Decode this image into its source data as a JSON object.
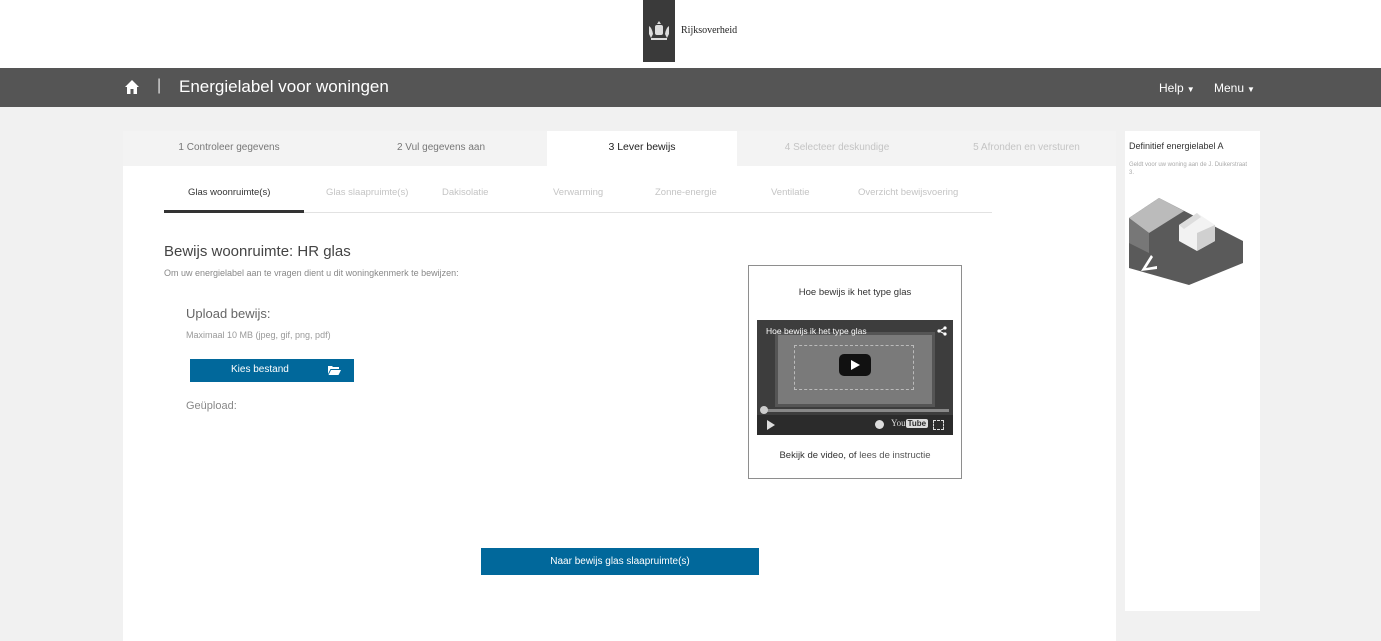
{
  "header": {
    "logo_text": "Rijksoverheid"
  },
  "navbar": {
    "separator": "|",
    "title": "Energielabel voor woningen",
    "help": "Help",
    "menu": "Menu"
  },
  "steps": [
    {
      "label": "1 Controleer gegevens",
      "state": "done"
    },
    {
      "label": "2 Vul gegevens aan",
      "state": "done"
    },
    {
      "label": "3 Lever bewijs",
      "state": "active"
    },
    {
      "label": "4 Selecteer deskundige",
      "state": "disabled"
    },
    {
      "label": "5 Afronden en versturen",
      "state": "disabled"
    }
  ],
  "subtabs": [
    {
      "label": "Glas woonruimte(s)",
      "active": true
    },
    {
      "label": "Glas slaapruimte(s)",
      "active": false
    },
    {
      "label": "Dakisolatie",
      "active": false
    },
    {
      "label": "Verwarming",
      "active": false
    },
    {
      "label": "Zonne-energie",
      "active": false
    },
    {
      "label": "Ventilatie",
      "active": false
    },
    {
      "label": "Overzicht bewijsvoering",
      "active": false
    }
  ],
  "content": {
    "heading": "Bewijs woonruimte: HR glas",
    "intro": "Om uw energielabel aan te vragen dient u dit woningkenmerk te bewijzen:",
    "upload_title": "Upload bewijs:",
    "upload_hint": "Maximaal 10 MB (jpeg, gif, png, pdf)",
    "choose_file": "Kies bestand",
    "uploaded_label": "Geüpload:",
    "next_button": "Naar bewijs glas slaapruimte(s)"
  },
  "video": {
    "box_title": "Hoe bewijs ik het type glas",
    "video_title": "Hoe bewijs ik het type glas",
    "youtube_label": "You",
    "youtube_badge": "Tube",
    "caption_prefix": "Bekijk de video, of ",
    "caption_link": "lees de instructie"
  },
  "sidebar": {
    "title": "Definitief energielabel A",
    "subtitle": "Geldt voor uw woning aan de J. Duikerstraat 3."
  },
  "colors": {
    "primary": "#01689b",
    "navbar": "#555555"
  }
}
